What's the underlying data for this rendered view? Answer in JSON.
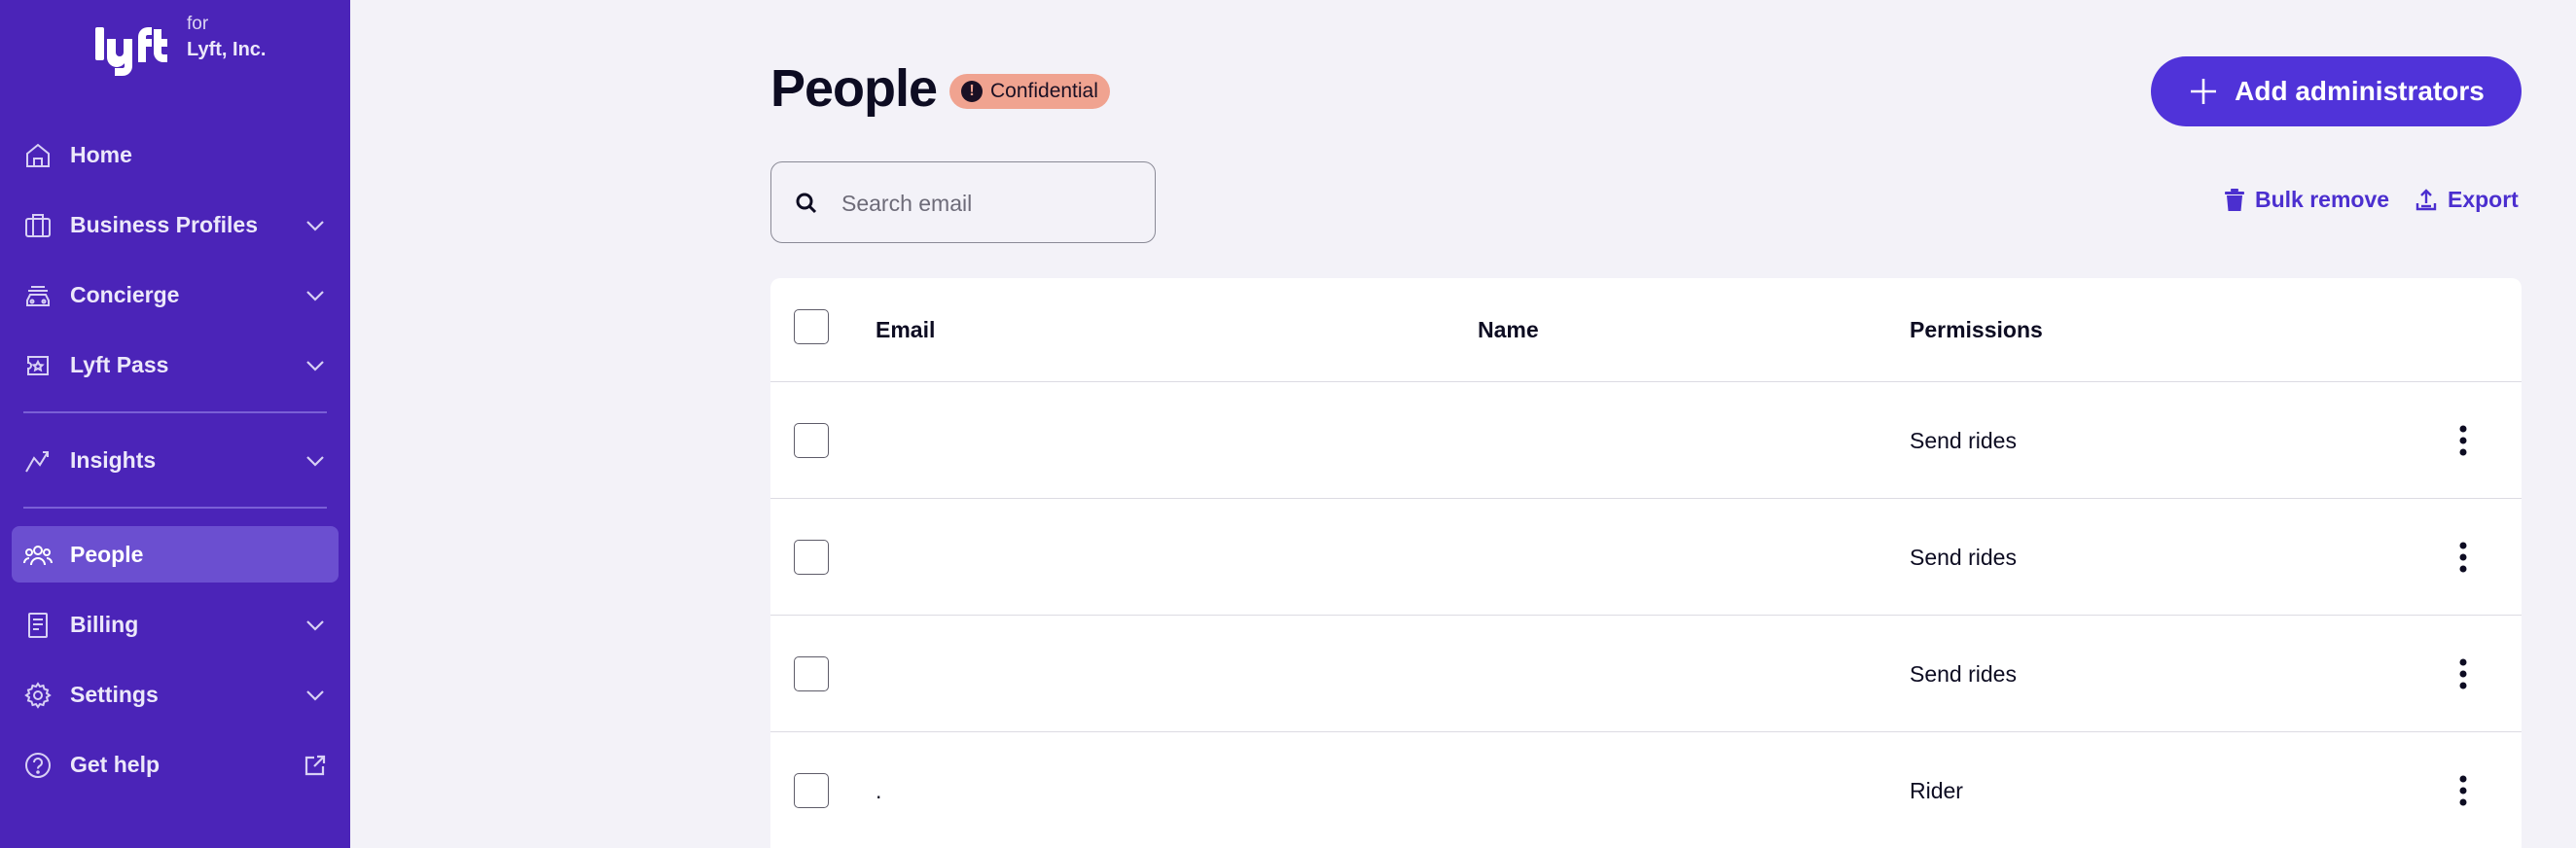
{
  "brand": {
    "for_text": "for",
    "company": "Lyft, Inc."
  },
  "sidebar": {
    "items": [
      {
        "label": "Home"
      },
      {
        "label": "Business Profiles"
      },
      {
        "label": "Concierge"
      },
      {
        "label": "Lyft Pass"
      },
      {
        "label": "Insights"
      },
      {
        "label": "People"
      },
      {
        "label": "Billing"
      },
      {
        "label": "Settings"
      },
      {
        "label": "Get help"
      }
    ],
    "active": "People"
  },
  "header": {
    "title": "People",
    "badge": "Confidential",
    "add_button": "Add administrators"
  },
  "search": {
    "placeholder": "Search email"
  },
  "actions": {
    "bulk_remove": "Bulk remove",
    "export": "Export"
  },
  "table": {
    "columns": [
      "Email",
      "Name",
      "Permissions"
    ],
    "rows": [
      {
        "email": "",
        "name": "",
        "permissions": "Send rides"
      },
      {
        "email": "",
        "name": "",
        "permissions": "Send rides"
      },
      {
        "email": "",
        "name": "",
        "permissions": "Send rides"
      },
      {
        "email": ".",
        "name": "",
        "permissions": "Rider"
      }
    ]
  },
  "colors": {
    "sidebar": "#4b24b8",
    "accent": "#5033d9",
    "badge": "#f0a390"
  }
}
